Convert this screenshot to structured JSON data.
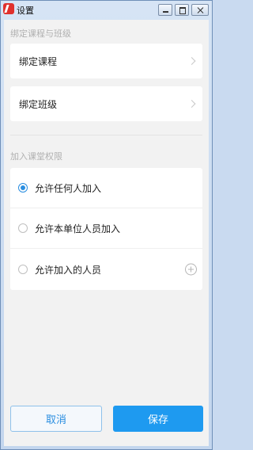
{
  "window": {
    "title": "设置"
  },
  "sections": {
    "bind_label": "绑定课程与班级",
    "permission_label": "加入课堂权限"
  },
  "bind_items": [
    {
      "label": "绑定课程"
    },
    {
      "label": "绑定班级"
    }
  ],
  "permission_options": [
    {
      "label": "允许任何人加入",
      "selected": true
    },
    {
      "label": "允许本单位人员加入",
      "selected": false
    },
    {
      "label": "允许加入的人员",
      "selected": false
    }
  ],
  "buttons": {
    "cancel": "取消",
    "save": "保存"
  },
  "colors": {
    "accent": "#1e9af0",
    "background": "#f2f2f2"
  },
  "icons": {
    "app": "app-logo-icon",
    "minimize": "minimize-icon",
    "maximize": "maximize-icon",
    "close": "close-icon",
    "chevron": "chevron-right-icon",
    "add": "add-circle-icon"
  }
}
